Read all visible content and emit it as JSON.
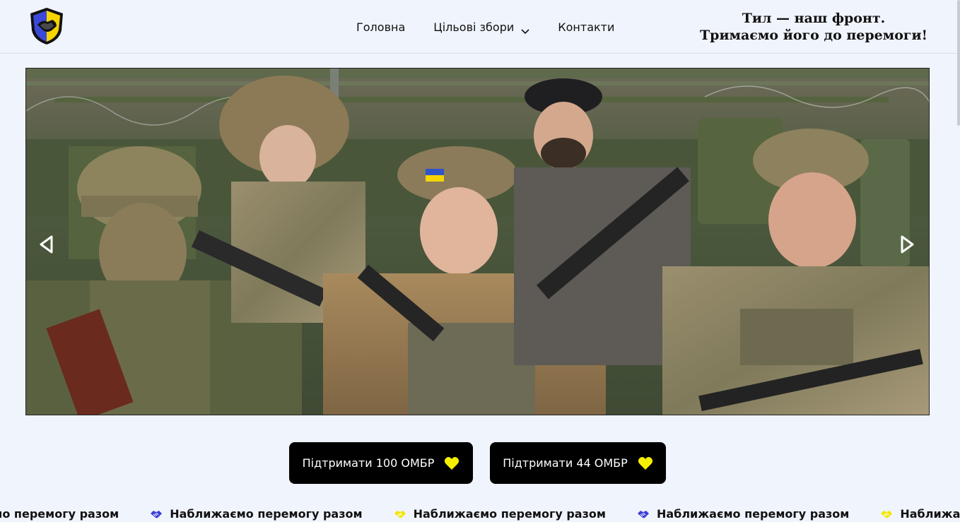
{
  "header": {
    "logo_icon": "shield-handshake-logo",
    "nav": [
      {
        "label": "Головна"
      },
      {
        "label": "Цільові збори",
        "icon": "chevron-down-icon"
      },
      {
        "label": "Контакти"
      }
    ],
    "slogan_line1": "Тил — наш фронт.",
    "slogan_line2": "Тримаємо його до перемоги!"
  },
  "hero": {
    "image_icon": "soldiers-photo",
    "prev_icon": "arrow-left-icon",
    "next_icon": "arrow-right-icon"
  },
  "actions": {
    "support_100": "Підтримати 100 ОМБР",
    "support_44": "Підтримати 44 ОМБР",
    "heart_color": "#f5f000"
  },
  "ticker": {
    "text": "Наближаємо перемогу разом",
    "partial_start": "аємо перемогу разом",
    "partial_end": "Наближаємо перемогу р",
    "icon_colors": [
      "#3a3fd6",
      "#f2e600"
    ]
  },
  "colors": {
    "background": "#f0f4fd",
    "button_bg": "#000000",
    "accent_blue": "#3b49d8",
    "accent_yellow": "#f5e400"
  }
}
